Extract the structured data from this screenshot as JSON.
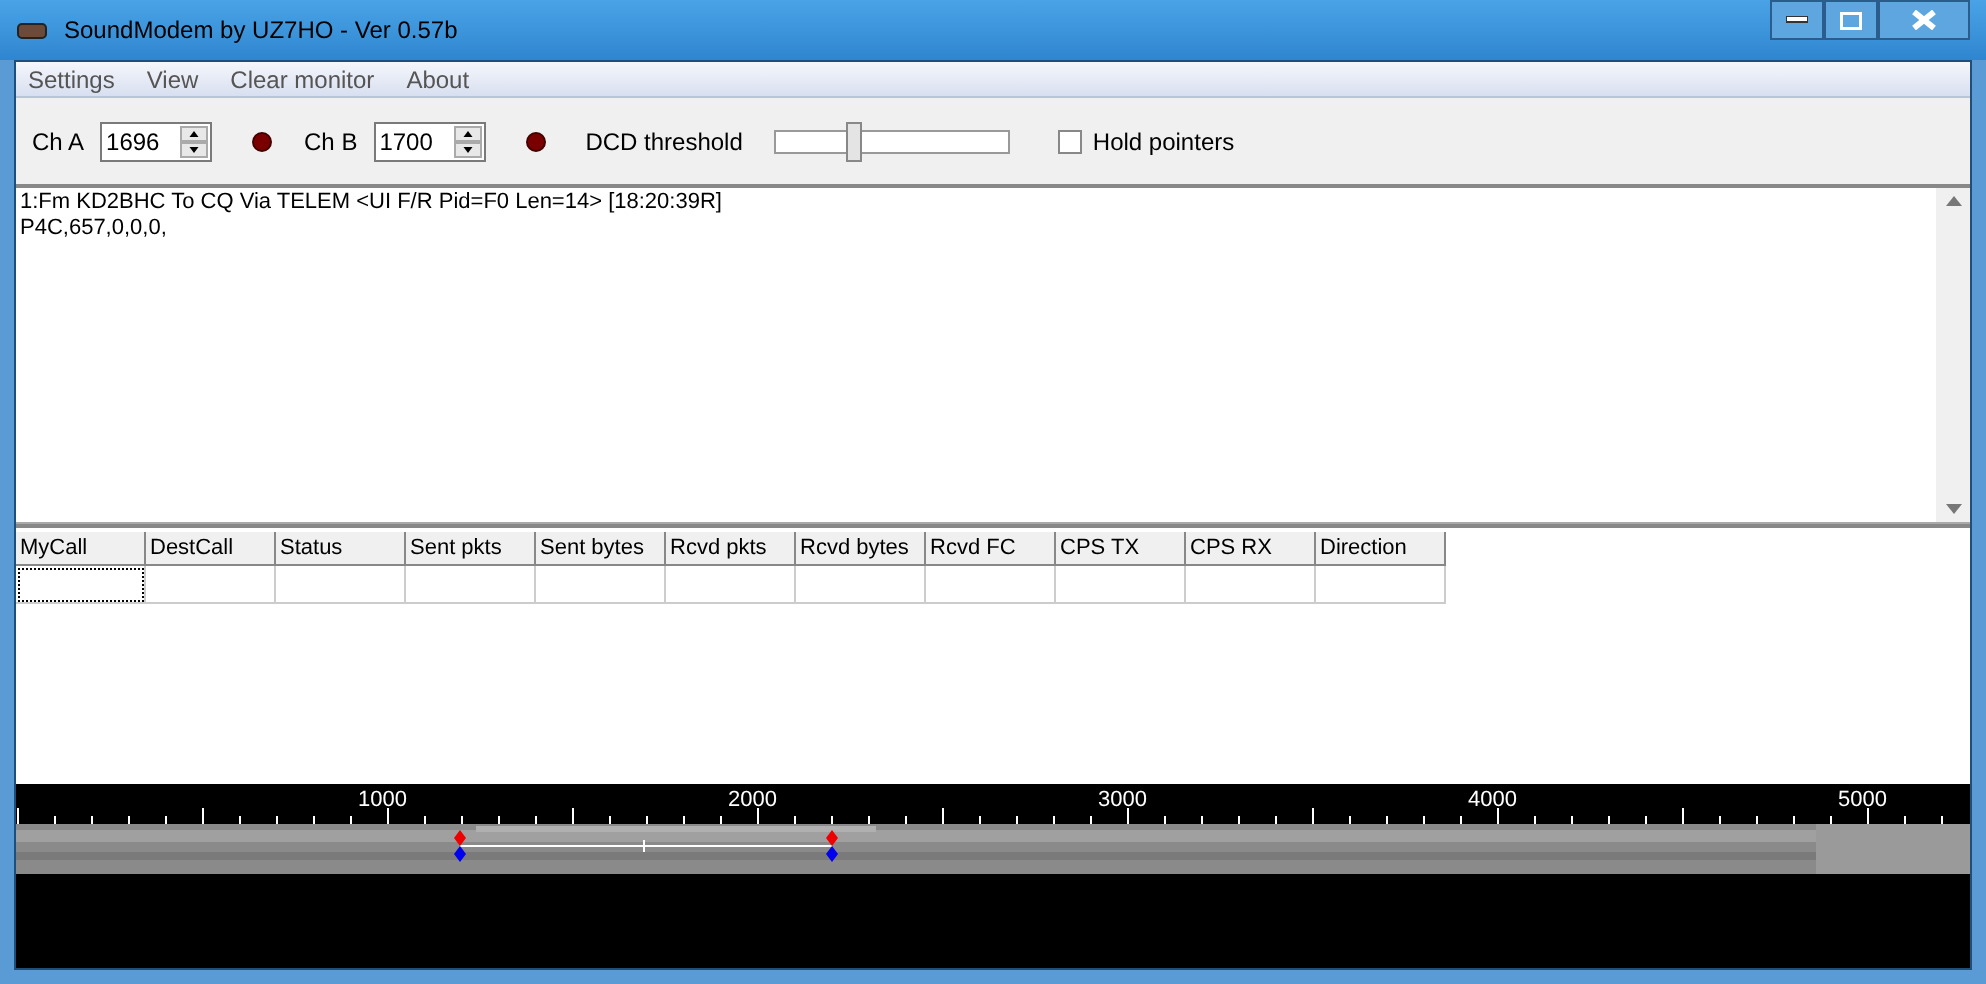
{
  "window": {
    "title": "SoundModem by UZ7HO - Ver 0.57b"
  },
  "menu": [
    "Settings",
    "View",
    "Clear monitor",
    "About"
  ],
  "toolbar": {
    "ch_a": {
      "label": "Ch A",
      "value": "1696"
    },
    "ch_b": {
      "label": "Ch B",
      "value": "1700"
    },
    "dcd": {
      "label": "DCD threshold",
      "level": 0.32
    },
    "hold_pointers": {
      "label": "Hold pointers",
      "checked": false
    }
  },
  "monitor": {
    "lines": [
      "1:Fm KD2BHC To CQ Via TELEM <UI F/R Pid=F0 Len=14> [18:20:39R]",
      "P4C,657,0,0,0,"
    ]
  },
  "table": {
    "columns": [
      "MyCall",
      "DestCall",
      "Status",
      "Sent pkts",
      "Sent bytes",
      "Rcvd pkts",
      "Rcvd bytes",
      "Rcvd FC",
      "CPS TX",
      "CPS RX",
      "Direction"
    ]
  },
  "spectrum": {
    "ticks": [
      "1000",
      "2000",
      "3000",
      "4000",
      "5000"
    ]
  }
}
